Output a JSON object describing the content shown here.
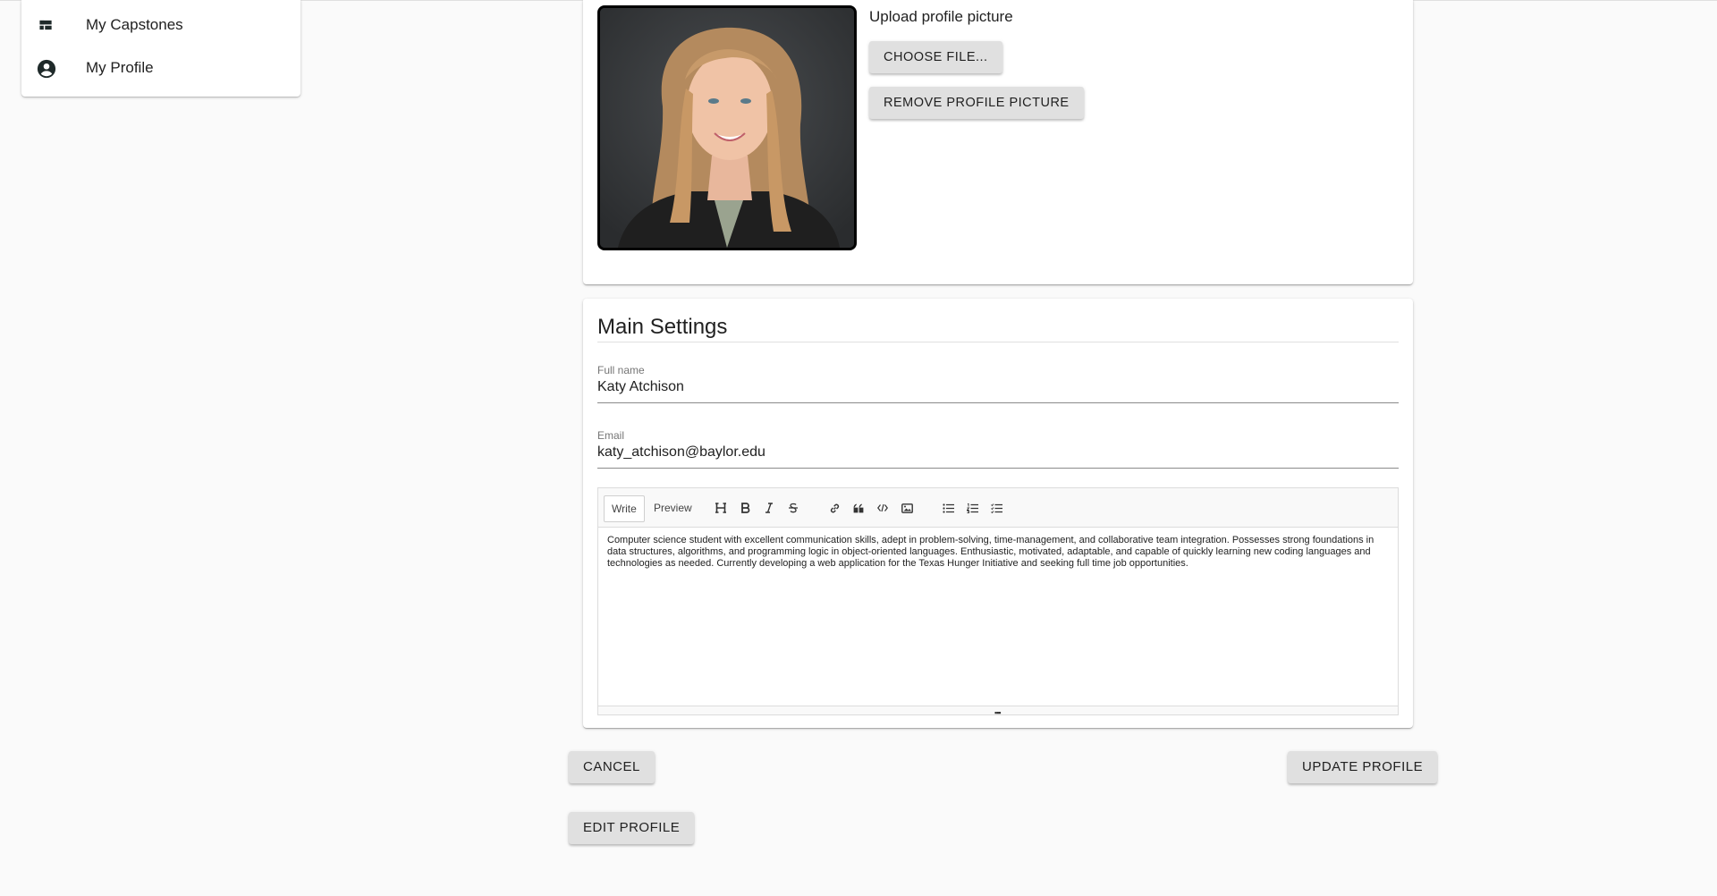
{
  "sidebar": {
    "items": [
      {
        "label": "My Capstones",
        "icon": "dashboard-icon"
      },
      {
        "label": "My Profile",
        "icon": "account-circle-icon"
      }
    ]
  },
  "photo_card": {
    "upload_label": "Upload profile picture",
    "choose_file_label": "CHOOSE FILE...",
    "remove_label": "REMOVE PROFILE PICTURE"
  },
  "main_settings": {
    "title": "Main Settings",
    "full_name": {
      "label": "Full name",
      "value": "Katy Atchison"
    },
    "email": {
      "label": "Email",
      "value": "katy_atchison@baylor.edu"
    },
    "editor": {
      "tab_write": "Write",
      "tab_preview": "Preview",
      "tools": [
        "heading-icon",
        "bold-icon",
        "italic-icon",
        "strikethrough-icon",
        "link-icon",
        "quote-icon",
        "code-icon",
        "image-icon",
        "bulleted-list-icon",
        "numbered-list-icon",
        "checklist-icon"
      ],
      "text": "Computer science student with excellent communication skills, adept in problem-solving, time-management, and collaborative team integration. Possesses strong foundations in data structures, algorithms, and programming logic in object-oriented languages. Enthusiastic, motivated, adaptable, and capable of quickly learning new coding languages and technologies as needed. Currently developing a web application for the Texas Hunger Initiative and seeking full time job opportunities."
    }
  },
  "actions": {
    "cancel_label": "CANCEL",
    "update_label": "UPDATE PROFILE",
    "edit_label": "EDIT PROFILE"
  },
  "colors": {
    "background": "#fafafa",
    "button": "#e0e0e0",
    "text": "#212121"
  }
}
